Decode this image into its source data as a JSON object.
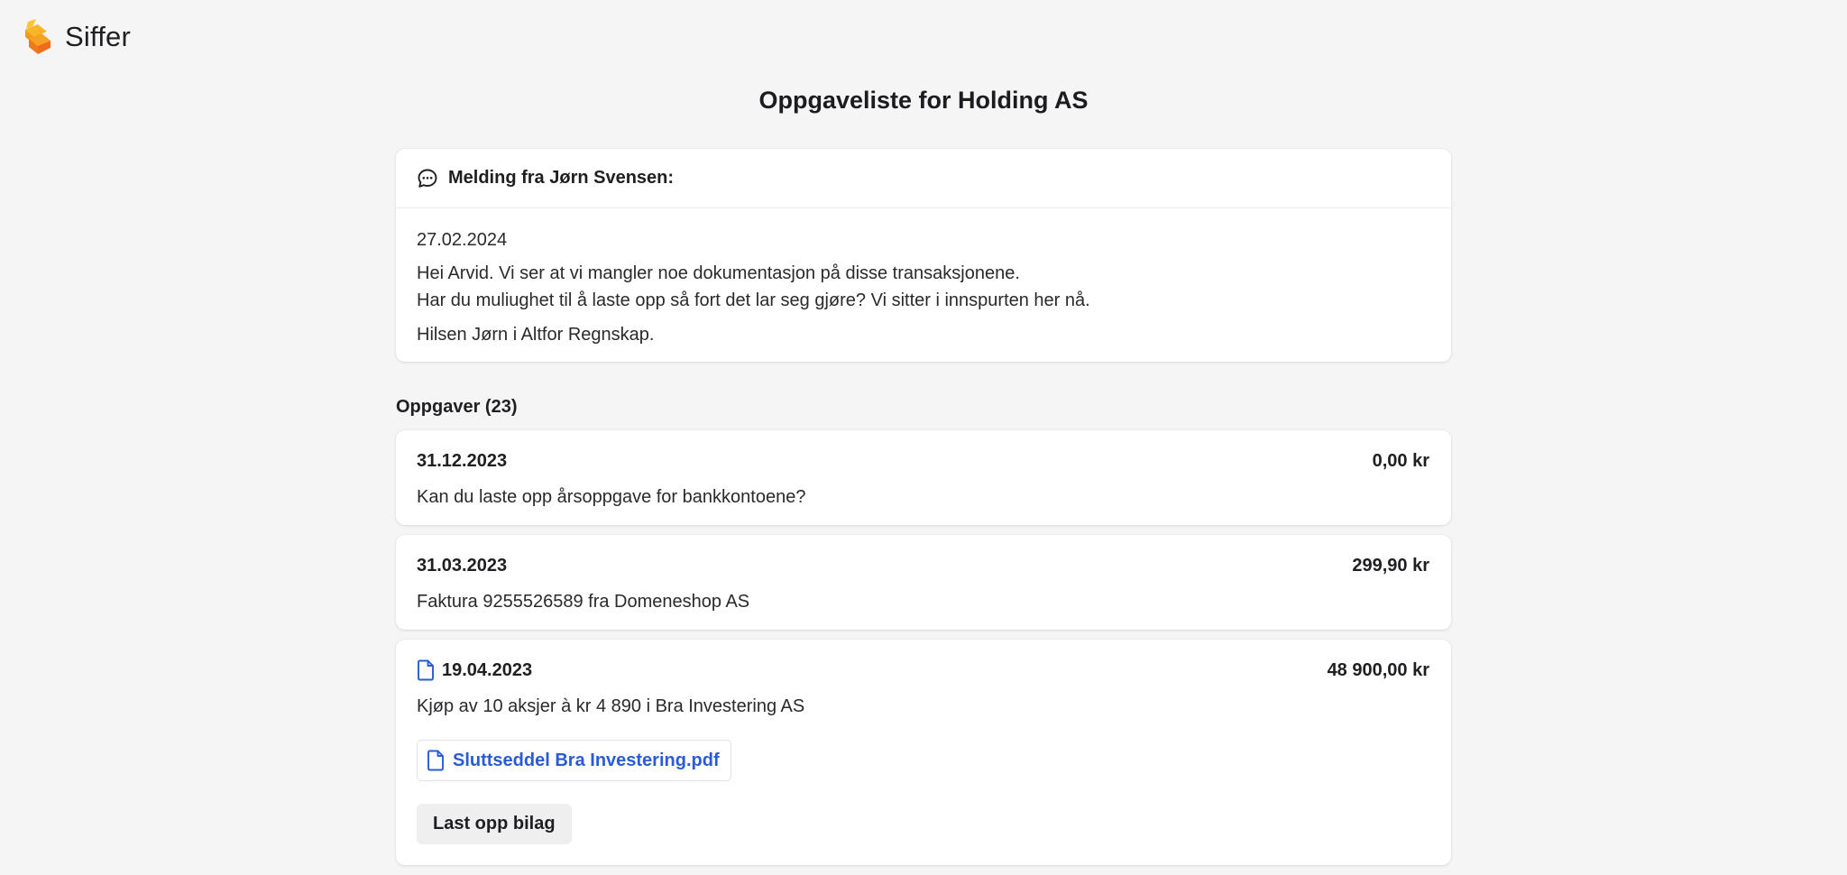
{
  "app": {
    "name": "Siffer",
    "logo_icon": "siffer-logo-icon",
    "brand_colors": [
      "#f7a21b",
      "#f26a1b"
    ]
  },
  "page": {
    "title": "Oppgaveliste for Holding AS"
  },
  "message": {
    "icon": "chat-bubble-icon",
    "title": "Melding fra Jørn Svensen:",
    "date": "27.02.2024",
    "lines": [
      "Hei Arvid. Vi ser at vi mangler noe dokumentasjon på disse transaksjonene.",
      "Har du muliughet til å laste opp så fort det lar seg gjøre? Vi sitter i innspurten her nå."
    ],
    "signature": "Hilsen Jørn i Altfor Regnskap."
  },
  "tasks": {
    "heading": "Oppgaver (23)",
    "items": [
      {
        "date": "31.12.2023",
        "amount": "0,00 kr",
        "description": "Kan du laste opp årsoppgave for bankkontoene?"
      },
      {
        "date": "31.03.2023",
        "amount": "299,90 kr",
        "description": "Faktura 9255526589 fra Domeneshop AS"
      },
      {
        "date": "19.04.2023",
        "amount": "48 900,00 kr",
        "description": "Kjøp av 10 aksjer à kr 4 890 i Bra Investering AS",
        "icon": "document-icon",
        "attachment": {
          "name": "Sluttseddel Bra Investering.pdf",
          "icon": "document-icon"
        },
        "upload_label": "Last opp bilag"
      }
    ]
  },
  "colors": {
    "link": "#2a5bd7",
    "background": "#f5f5f5",
    "card": "#ffffff"
  }
}
